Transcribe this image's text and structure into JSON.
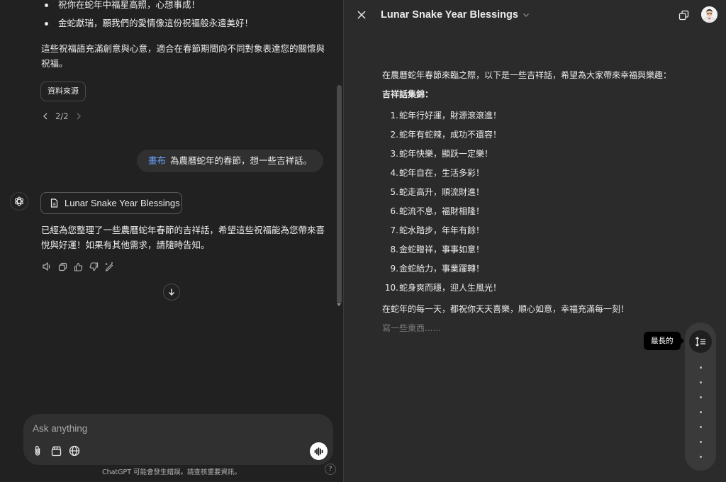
{
  "chat": {
    "bullets": [
      "祝你在蛇年中福星高照，心想事成！",
      "金蛇獻瑞，願我們的愛情像這份祝福般永遠美好！"
    ],
    "paragraph": "這些祝福語充滿創意與心意，適合在春節期間向不同對象表達您的關懷與祝福。",
    "sources_label": "資料來源",
    "pager": "2/2",
    "user_mention": "畫布",
    "user_message": "為農曆蛇年的春節，想一些吉祥話。",
    "canvas_card_title": "Lunar Snake Year Blessings",
    "assistant_reply": "已經為您整理了一些農曆蛇年春節的吉祥話，希望這些祝福能為您帶來喜悅與好運！如果有其他需求，請隨時告知。",
    "composer_placeholder": "Ask anything",
    "disclaimer": "ChatGPT 可能會發生錯誤。請查核重要資訊。",
    "help_label": "?"
  },
  "canvas": {
    "title": "Lunar Snake Year Blessings",
    "intro": "在農曆蛇年春節來臨之際，以下是一些吉祥話，希望為大家帶來幸福與樂趣：",
    "heading": "吉祥話集錦：",
    "items": [
      {
        "num": "1.",
        "text": "蛇年行好運，財源滾滾進！"
      },
      {
        "num": "2.",
        "text": "蛇年有蛇辣，成功不還容！"
      },
      {
        "num": "3.",
        "text": "蛇年快樂，顯跃一定樂！"
      },
      {
        "num": "4.",
        "text": "蛇年自在，生活多彩！"
      },
      {
        "num": "5.",
        "text": "蛇走高升，順流財進！"
      },
      {
        "num": "6.",
        "text": "蛇流不息，福財相隆！"
      },
      {
        "num": "7.",
        "text": "蛇水踏步，年年有餘！"
      },
      {
        "num": "8.",
        "text": "金蛇贈祥，事事如意！"
      },
      {
        "num": "9.",
        "text": "金蛇給力，事業躍轉！"
      },
      {
        "num": "10.",
        "text": "蛇身爽而穩，迎人生風光！"
      }
    ],
    "closing": "在蛇年的每一天，都祝你天天喜樂，順心如意，幸福充滿每一刻！",
    "placeholder": "寫一些東西......",
    "length_tooltip": "最長的"
  },
  "colors": {
    "background": "#212121",
    "canvas_background": "#2b2b2b",
    "composer": "#303030",
    "mention": "#6aa0ff",
    "text": "#ececec"
  }
}
